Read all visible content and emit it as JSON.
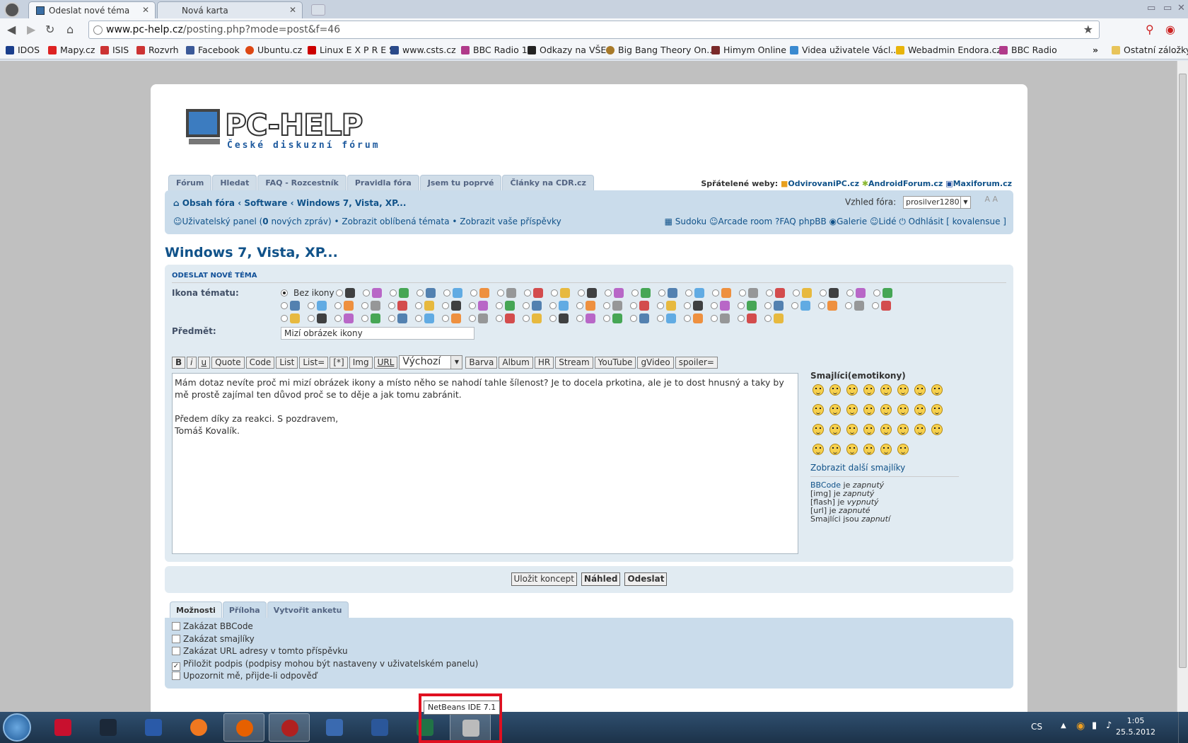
{
  "browser": {
    "tabs": [
      {
        "title": "Odeslat nové téma",
        "active": true
      },
      {
        "title": "Nová karta",
        "active": false
      }
    ],
    "url_host": "www.pc-help.cz",
    "url_path": "/posting.php?mode=post&f=46",
    "bookmarks": [
      "IDOS",
      "Mapy.cz",
      "ISIS",
      "Rozvrh",
      "Facebook",
      "Ubuntu.cz",
      "Linux E X P R E S",
      "www.csts.cz",
      "BBC Radio 1",
      "Odkazy na VŠE",
      "Big Bang Theory On...",
      "Himym Online",
      "Videa uživatele Václ...",
      "Webadmin Endora.cz",
      "BBC Radio"
    ],
    "bookmarks_overflow": "»",
    "other_bookmarks": "Ostatní záložky"
  },
  "site": {
    "logo_brand": "PC-HELP",
    "logo_tagline": "České diskuzní fórum",
    "nav_tabs": [
      "Fórum",
      "Hledat",
      "FAQ - Rozcestník",
      "Pravidla fóra",
      "Jsem tu poprvé",
      "Články na CDR.cz"
    ],
    "friends_label": "Spřátelené weby:",
    "friends": [
      "OdvirovaniPC.cz",
      "AndroidForum.cz",
      "Maxiforum.cz"
    ],
    "breadcrumb": [
      "Obsah fóra",
      "Software",
      "Windows 7, Vista, XP..."
    ],
    "style_label": "Vzhled fóra:",
    "style_value": "prosilver1280",
    "font_resize": "A A",
    "userbar": {
      "ucp_prefix": "Uživatelský panel (",
      "pm_count": "0",
      "ucp_suffix": " nových zpráv)",
      "favorites": "Zobrazit oblíbená témata",
      "my_posts": "Zobrazit vaše příspěvky"
    },
    "userbar_right": [
      "Sudoku",
      "Arcade room",
      "FAQ phpBB",
      "Galerie",
      "Lidé",
      "Odhlásit [ kovalensue ]"
    ]
  },
  "post": {
    "page_title": "Windows 7, Vista, XP...",
    "panel_heading": "ODESLAT NOVÉ TÉMA",
    "topic_icon_label": "Ikona tématu:",
    "no_icon_label": "Bez ikony",
    "subject_label": "Předmět:",
    "subject_value": "Mizí obrázek ikony",
    "bbcode_buttons": [
      "B",
      "i",
      "u",
      "Quote",
      "Code",
      "List",
      "List=",
      "[*]",
      "Img",
      "URL"
    ],
    "font_size_select": "Výchozí",
    "bbcode_buttons_2": [
      "Barva",
      "Album",
      "HR",
      "Stream",
      "YouTube",
      "gVideo",
      "spoiler="
    ],
    "message": "Mám dotaz nevíte proč mi mizí obrázek ikony a místo něho se nahodí tahle šílenost? Je to docela prkotina, ale je to dost hnusný a taky by mě prostě zajímal ten důvod proč se to děje a jak tomu zabránit.\n\nPředem díky za reakci. S pozdravem,\nTomáš Kovalík.",
    "smilies_heading": "Smajlíci(emotikony)",
    "more_smilies": "Zobrazit další smajlíky",
    "bbcode_status": [
      {
        "name": "BBCode",
        "word": " je ",
        "state": "zapnutý"
      },
      {
        "name": "[img]",
        "word": " je ",
        "state": "zapnutý"
      },
      {
        "name": "[flash]",
        "word": " je ",
        "state": "vypnutý"
      },
      {
        "name": "[url]",
        "word": " je ",
        "state": "zapnuté"
      },
      {
        "name": "Smajlíci",
        "word": " jsou ",
        "state": "zapnutí"
      }
    ],
    "submit_buttons": [
      "Uložit koncept",
      "Náhled",
      "Odeslat"
    ],
    "option_tabs": [
      "Možnosti",
      "Příloha",
      "Vytvořit anketu"
    ],
    "options": [
      {
        "label": "Zakázat BBCode",
        "checked": false
      },
      {
        "label": "Zakázat smajlíky",
        "checked": false
      },
      {
        "label": "Zakázat URL adresy v tomto příspěvku",
        "checked": false
      },
      {
        "label": "Přiložit podpis (podpisy mohou být nastaveny v uživatelském panelu)",
        "checked": true
      },
      {
        "label": "Upozornit mě, přijde-li odpověď",
        "checked": false
      }
    ]
  },
  "taskbar": {
    "tooltip": "NetBeans IDE 7.1",
    "language": "CS",
    "time": "1:05",
    "date": "25.5.2012",
    "apps": [
      "radeon-icon",
      "steam-icon",
      "floppy-icon",
      "orange-icon",
      "firefox-icon",
      "opera-icon",
      "virtualbox-icon",
      "word-icon",
      "excel-icon",
      "netbeans-icon"
    ],
    "accent_highlight": "#e01020"
  }
}
